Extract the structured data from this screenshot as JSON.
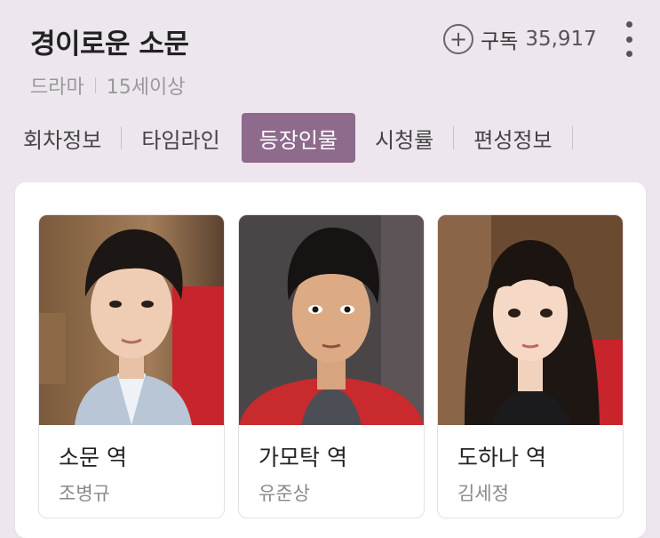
{
  "header": {
    "title": "경이로운 소문",
    "genre": "드라마",
    "rating": "15세이상",
    "subscribe_label": "구독",
    "subscriber_count": "35,917"
  },
  "tabs": [
    {
      "label": "회차정보"
    },
    {
      "label": "타임라인"
    },
    {
      "label": "등장인물",
      "active": true
    },
    {
      "label": "시청률"
    },
    {
      "label": "편성정보"
    }
  ],
  "cast": [
    {
      "role": "소문 역",
      "actor": "조병규"
    },
    {
      "role": "가모탁 역",
      "actor": "유준상"
    },
    {
      "role": "도하나 역",
      "actor": "김세정"
    }
  ],
  "colors": {
    "background": "#ede6ee",
    "active_tab": "#8e6a8c"
  },
  "icons": {
    "subscribe": "plus-circle-icon",
    "more": "more-vertical-icon"
  }
}
